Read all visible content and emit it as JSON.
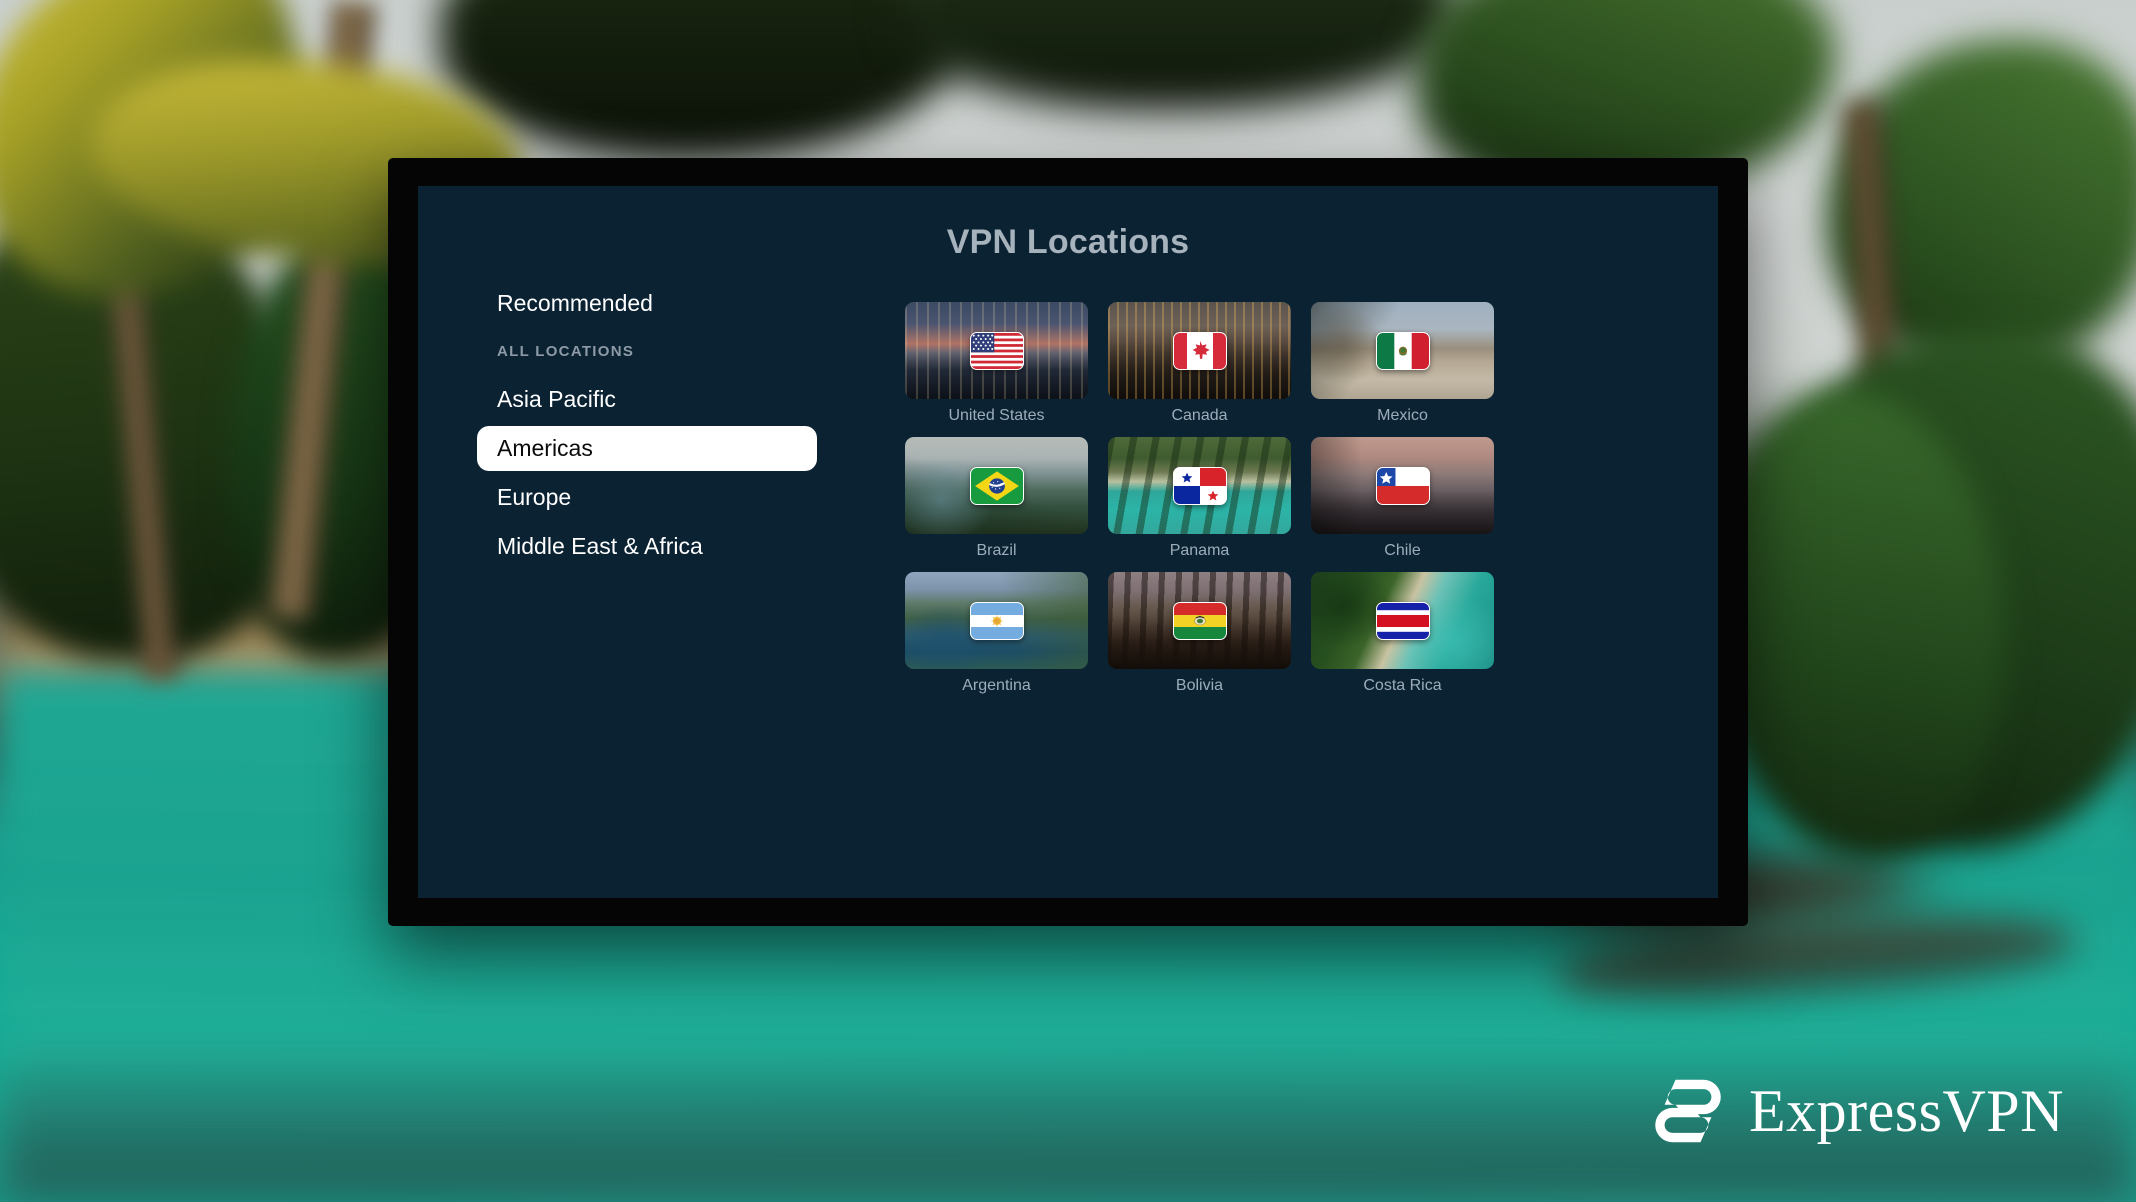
{
  "screen": {
    "title": "VPN Locations",
    "sidebar": {
      "recommended_label": "Recommended",
      "section_label": "ALL LOCATIONS",
      "items": [
        {
          "label": "Asia Pacific",
          "selected": false
        },
        {
          "label": "Americas",
          "selected": true
        },
        {
          "label": "Europe",
          "selected": false
        },
        {
          "label": "Middle East & Africa",
          "selected": false
        }
      ]
    },
    "locations": [
      {
        "name": "United States",
        "flag": "flag-united-states",
        "scene": "new-york-skyline-at-dusk"
      },
      {
        "name": "Canada",
        "flag": "flag-canada",
        "scene": "toronto-skyline-at-night"
      },
      {
        "name": "Mexico",
        "flag": "flag-mexico",
        "scene": "mexico-city-zocalo-square"
      },
      {
        "name": "Brazil",
        "flag": "flag-brazil",
        "scene": "rio-de-janeiro-coastline"
      },
      {
        "name": "Panama",
        "flag": "flag-panama",
        "scene": "tropical-island-with-canoe"
      },
      {
        "name": "Chile",
        "flag": "flag-chile",
        "scene": "santiago-skyline-with-mountains"
      },
      {
        "name": "Argentina",
        "flag": "flag-argentina",
        "scene": "patagonia-lake-and-forest"
      },
      {
        "name": "Bolivia",
        "flag": "flag-bolivia",
        "scene": "llama-herd-on-altiplano"
      },
      {
        "name": "Costa Rica",
        "flag": "flag-costa-rica",
        "scene": "aerial-beach-and-rainforest"
      }
    ]
  },
  "branding": {
    "wordmark": "ExpressVPN",
    "logo_icon": "expressvpn-e-mark"
  },
  "colors": {
    "screen_background": "#0b2233",
    "title_text": "#a6b3bc",
    "nav_text": "#ffffff",
    "nav_selected_background": "#ffffff",
    "nav_selected_text": "#0b0b0b",
    "section_label_text": "#8d9aa5",
    "card_label_text": "#9cadba",
    "bezel": "#050505",
    "logo": "#ffffff"
  }
}
